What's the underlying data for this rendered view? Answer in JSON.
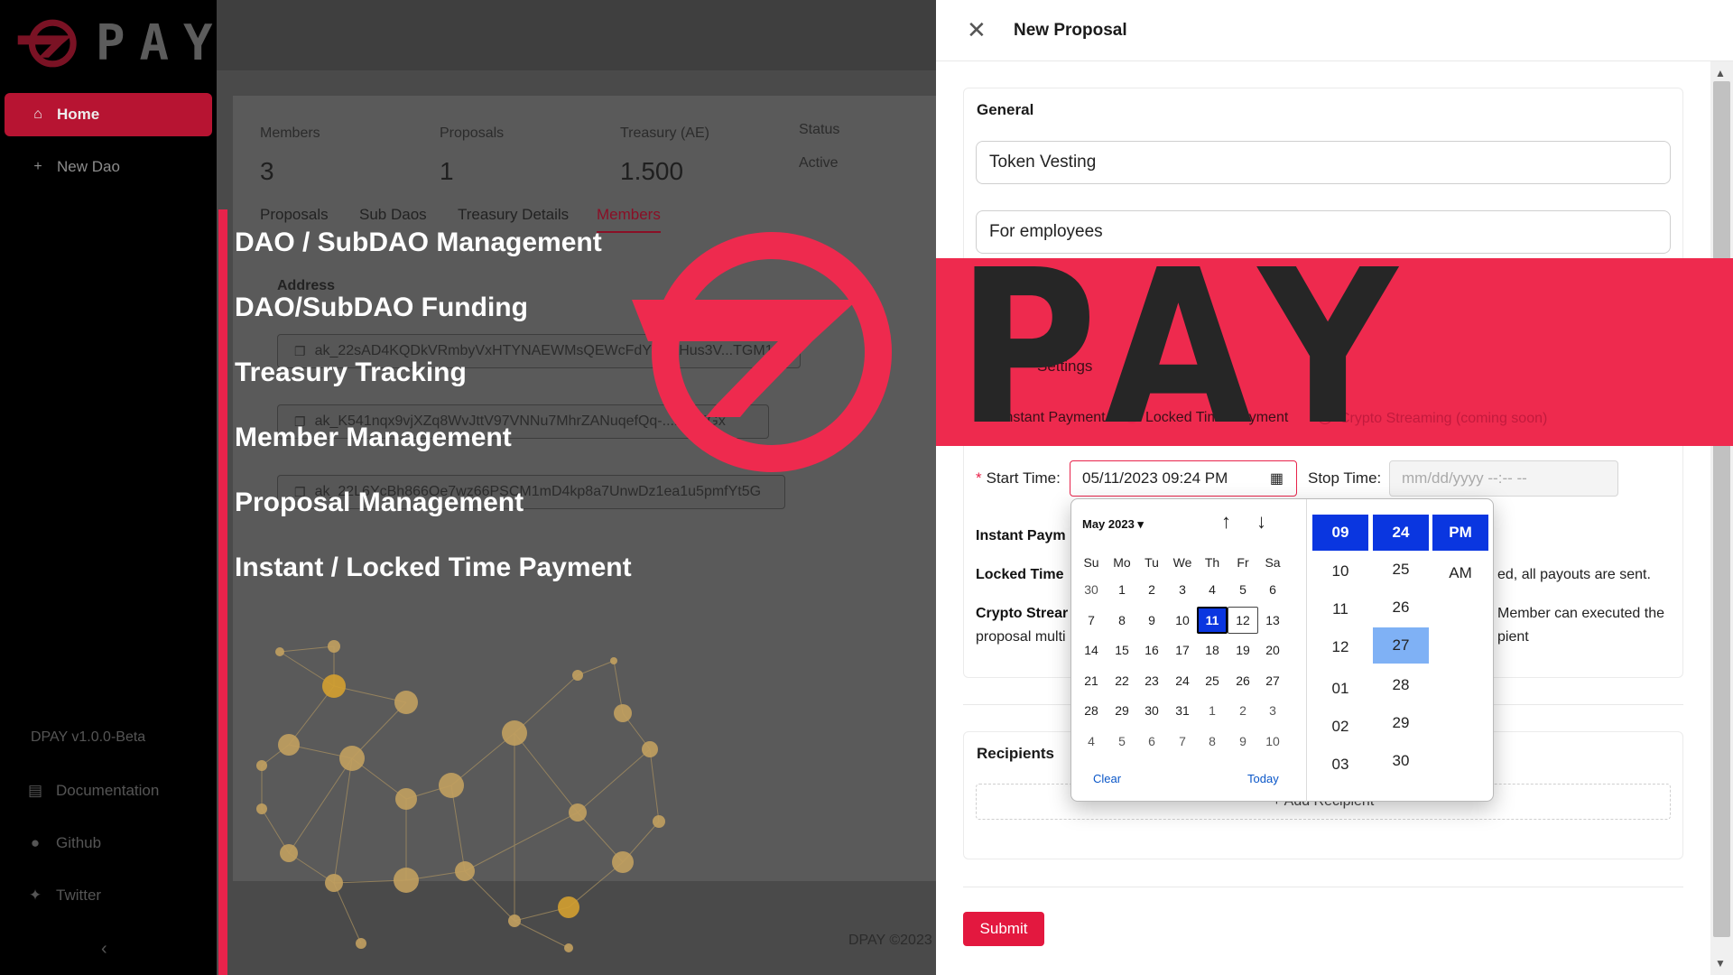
{
  "brand": {
    "logo_text": "PAY",
    "accent": "#e8234b"
  },
  "sidebar": {
    "items": [
      {
        "label": "Home",
        "icon": "home-icon"
      },
      {
        "label": "New Dao",
        "icon": "plus-icon"
      }
    ],
    "version": "DPAY v1.0.0-Beta",
    "links": [
      {
        "label": "Documentation",
        "icon": "document-icon"
      },
      {
        "label": "Github",
        "icon": "github-icon"
      },
      {
        "label": "Twitter",
        "icon": "twitter-icon"
      }
    ],
    "collapse_glyph": "‹"
  },
  "dashboard": {
    "stats": [
      {
        "label": "Members",
        "value": "3"
      },
      {
        "label": "Proposals",
        "value": "1"
      },
      {
        "label": "Treasury (AE)",
        "value": "1.500"
      },
      {
        "label": "Status",
        "value": "Active"
      }
    ],
    "tabs": [
      "Proposals",
      "Sub Daos",
      "Treasury Details",
      "Members"
    ],
    "active_tab": "Members",
    "address_header": "Address",
    "addresses": [
      "ak_22sAD4KQDkVRmbyVxHTYNAEWMsQEWcFdYc...aHus3V...TGM12",
      "ak_K541nqx9vjXZq8WvJttV97VNNu7MhrZANuqefQq-...DiAKGx",
      "ak_22L6YcBh866Oe7wz66PSCM1mD4kp8a7UnwDz1ea1u5pmfYt5G"
    ],
    "footer": "DPAY ©2023"
  },
  "promo": {
    "features": [
      "DAO / SubDAO Management",
      "DAO/SubDAO Funding",
      "Treasury Tracking",
      "Member Management",
      "Proposal Management",
      "Instant / Locked Time Payment"
    ],
    "banner_text": "PAY"
  },
  "drawer": {
    "title": "New Proposal",
    "general_title": "General",
    "name_value": "Token Vesting",
    "description_value": "For employees",
    "settings_title": "Settings",
    "payment_types": [
      "Instant Payment",
      "Locked Time Payment",
      "Crypto Streaming (coming soon)"
    ],
    "start_label": "Start Time:",
    "start_value": "05/11/2023 09:24 PM",
    "stop_label": "Stop Time:",
    "stop_placeholder": "mm/dd/yyyy --:-- --",
    "desc_instant_label": "Instant Paym",
    "desc_locked_label": "Locked Time",
    "desc_locked_tail": "ed, all payouts are sent.",
    "desc_stream_label": "Crypto Strear",
    "desc_stream_tail": "Member can executed the",
    "desc_stream_line2_head": "proposal multi",
    "desc_stream_line2_tail": "pient",
    "recipients_title": "Recipients",
    "add_recipient": "+ Add Recipient",
    "submit": "Submit"
  },
  "picker": {
    "month_label": "May 2023 ▾",
    "weekdays": [
      "Su",
      "Mo",
      "Tu",
      "We",
      "Th",
      "Fr",
      "Sa"
    ],
    "days": [
      [
        "30",
        "1",
        "2",
        "3",
        "4",
        "5",
        "6"
      ],
      [
        "7",
        "8",
        "9",
        "10",
        "11",
        "12",
        "13"
      ],
      [
        "14",
        "15",
        "16",
        "17",
        "18",
        "19",
        "20"
      ],
      [
        "21",
        "22",
        "23",
        "24",
        "25",
        "26",
        "27"
      ],
      [
        "28",
        "29",
        "30",
        "31",
        "1",
        "2",
        "3"
      ],
      [
        "4",
        "5",
        "6",
        "7",
        "8",
        "9",
        "10"
      ]
    ],
    "selected_day": "11",
    "today_day": "12",
    "clear": "Clear",
    "today": "Today",
    "hours": [
      "09",
      "10",
      "11",
      "12",
      "01",
      "02",
      "03"
    ],
    "minutes": [
      "24",
      "25",
      "26",
      "27",
      "28",
      "29",
      "30"
    ],
    "meridiem": [
      "PM",
      "AM"
    ],
    "selected_hour": "09",
    "selected_minute": "24",
    "hover_minute": "27",
    "selected_meridiem": "PM"
  }
}
